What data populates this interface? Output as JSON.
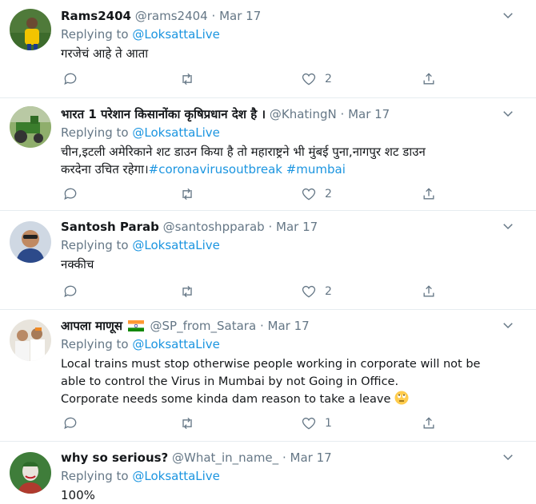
{
  "tweets": [
    {
      "name": "Rams2404",
      "handle": "@rams2404",
      "dot": "·",
      "date": "Mar 17",
      "replying_prefix": "Replying to",
      "replying_to": "@LoksattaLive",
      "body_lines": [
        "गरजेचं आहे ते आता"
      ],
      "like_count": "2",
      "reply_count": "",
      "retweet_count": ""
    },
    {
      "name": "भारत 1 परेशान किसानोंका कृषिप्रधान देश है ।",
      "handle": "@KhatingN",
      "dot": "·",
      "date": "Mar 17",
      "replying_prefix": "Replying to",
      "replying_to": "@LoksattaLive",
      "body_line1": "चीन,इटली अमेरिकाने शट डाउन किया है  तो महाराष्ट्रने भी मुंबई  पुना,नागपुर शट डाउन",
      "body_line2_text": "करदेना उचित रहेगा।",
      "body_line2_tag1": "#coronavirusoutbreak",
      "body_line2_tag2": "#mumbai",
      "like_count": "2"
    },
    {
      "name": "Santosh Parab",
      "handle": "@santoshpparab",
      "dot": "·",
      "date": "Mar 17",
      "replying_prefix": "Replying to",
      "replying_to": "@LoksattaLive",
      "body_lines": [
        "नक्कीच"
      ],
      "like_count": "2"
    },
    {
      "name": "आपला माणूस",
      "handle": "@SP_from_Satara",
      "dot": "·",
      "date": "Mar 17",
      "replying_prefix": "Replying to",
      "replying_to": "@LoksattaLive",
      "body_lines": [
        "Local trains must stop otherwise people working in corporate will not be",
        "able to control the Virus in Mumbai by not Going in Office.",
        "Corporate needs some kinda dam reason to take a leave"
      ],
      "like_count": "1"
    },
    {
      "name": "why so serious?",
      "handle": "@What_in_name_",
      "dot": "·",
      "date": "Mar 17",
      "replying_prefix": "Replying to",
      "replying_to": "@LoksattaLive",
      "body_lines": [
        "100%"
      ]
    }
  ],
  "icons": {
    "reply": "reply-icon",
    "retweet": "retweet-icon",
    "like": "heart-icon",
    "share": "share-icon",
    "more": "chevron-down-icon",
    "flag": "india-flag-icon",
    "emoji": "rolling-eyes-emoji-icon"
  },
  "colors": {
    "link": "#1b95e0",
    "muted": "#657786",
    "text": "#14171a",
    "divider": "#e6ecf0"
  }
}
